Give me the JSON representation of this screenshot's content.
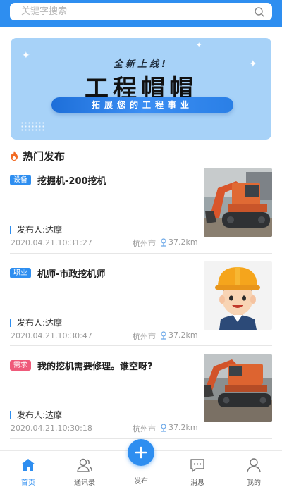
{
  "search": {
    "placeholder": "关键字搜索"
  },
  "banner": {
    "subtitle": "全新上线!",
    "title": "工程帽帽",
    "slogan": "拓展您的工程事业"
  },
  "section": {
    "title": "热门发布"
  },
  "posts": [
    {
      "tag": "设备",
      "tag_color": "#2e8ef0",
      "title": "挖掘机-200挖机",
      "publisher": "发布人:达摩",
      "date": "2020.04.21.10:31:27",
      "city": "杭州市",
      "distance": "37.2km",
      "image": "excavator"
    },
    {
      "tag": "职业",
      "tag_color": "#2e8ef0",
      "title": "机师-市政挖机师",
      "publisher": "发布人:达摩",
      "date": "2020.04.21.10:30:47",
      "city": "杭州市",
      "distance": "37.2km",
      "image": "worker-avatar"
    },
    {
      "tag": "需求",
      "tag_color": "#ef5a7a",
      "title": "我的挖机需要修理。谁空呀?",
      "publisher": "发布人:达摩",
      "date": "2020.04.21.10:30:18",
      "city": "杭州市",
      "distance": "37.2km",
      "image": "excavator"
    }
  ],
  "tabbar": {
    "home": "首页",
    "contacts": "通讯录",
    "publish": "发布",
    "messages": "消息",
    "mine": "我的",
    "active_color": "#2e8ef0"
  }
}
